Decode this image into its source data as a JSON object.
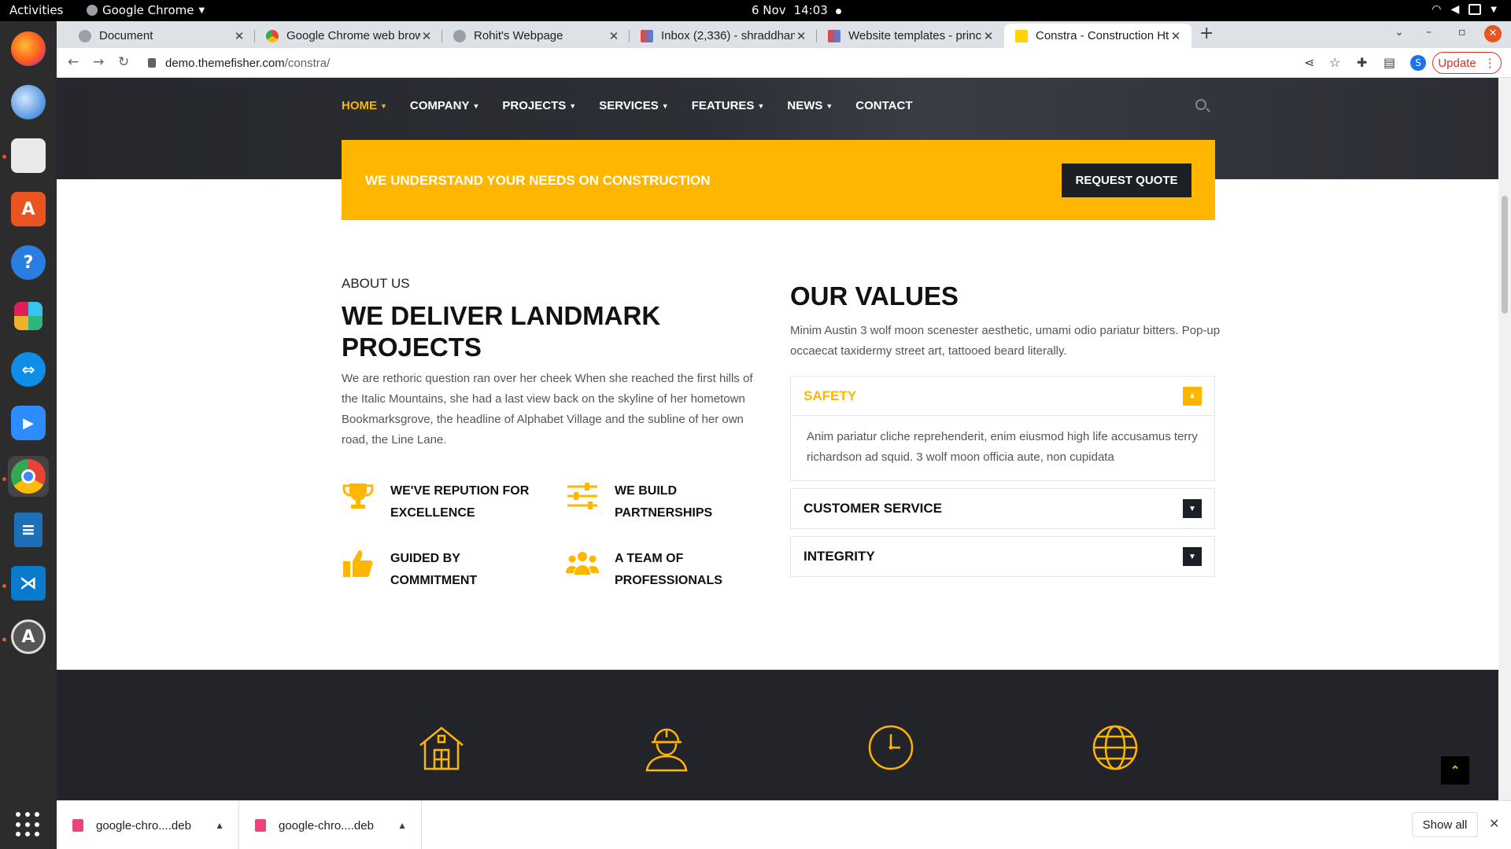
{
  "system": {
    "activities": "Activities",
    "app_name": "Google Chrome",
    "date": "6 Nov",
    "time": "14:03"
  },
  "dock": {
    "apps": [
      "Firefox",
      "Thunderbird",
      "Files",
      "Ubuntu Software",
      "Help",
      "Slack",
      "TeamViewer",
      "Zoom",
      "Google Chrome",
      "LibreOffice Writer",
      "Visual Studio Code",
      "Software Updater"
    ]
  },
  "browser": {
    "tabs": [
      {
        "title": "Document"
      },
      {
        "title": "Google Chrome web brow"
      },
      {
        "title": "Rohit's Webpage"
      },
      {
        "title": "Inbox (2,336) - shraddham"
      },
      {
        "title": "Website templates - princ"
      },
      {
        "title": "Constra - Construction Ht"
      }
    ],
    "url_host": "demo.themefisher.com",
    "url_path": "/constra/",
    "profile_initial": "S",
    "update_label": "Update"
  },
  "site": {
    "nav": [
      "HOME",
      "COMPANY",
      "PROJECTS",
      "SERVICES",
      "FEATURES",
      "NEWS",
      "CONTACT"
    ],
    "cta_text": "WE UNDERSTAND YOUR NEEDS ON CONSTRUCTION",
    "cta_button": "REQUEST QUOTE",
    "about": {
      "kicker": "ABOUT US",
      "title": "WE DELIVER LANDMARK PROJECTS",
      "text": "We are rethoric question ran over her cheek When she reached the first hills of the Italic Mountains, she had a last view back on the skyline of her hometown Bookmarksgrove, the headline of Alphabet Village and the subline of her own road, the Line Lane.",
      "features": [
        {
          "icon": "trophy-icon",
          "label": "WE'VE REPUTION FOR EXCELLENCE"
        },
        {
          "icon": "sliders-icon",
          "label": "WE BUILD PARTNERSHIPS"
        },
        {
          "icon": "thumbs-up-icon",
          "label": "GUIDED BY COMMITMENT"
        },
        {
          "icon": "users-icon",
          "label": "A TEAM OF PROFESSIONALS"
        }
      ]
    },
    "values": {
      "title": "OUR VALUES",
      "text": "Minim Austin 3 wolf moon scenester aesthetic, umami odio pariatur bitters. Pop-up occaecat taxidermy street art, tattooed beard literally.",
      "items": [
        {
          "title": "SAFETY",
          "body": "Anim pariatur cliche reprehenderit, enim eiusmod high life accusamus terry richardson ad squid. 3 wolf moon officia aute, non cupidata"
        },
        {
          "title": "CUSTOMER SERVICE"
        },
        {
          "title": "INTEGRITY"
        }
      ]
    },
    "facts_icons": [
      "house-icon",
      "worker-icon",
      "clock-icon",
      "globe-icon"
    ],
    "accent": "#ffb600"
  },
  "downloads": {
    "items": [
      "google-chro....deb",
      "google-chro....deb"
    ],
    "show_all": "Show all"
  }
}
